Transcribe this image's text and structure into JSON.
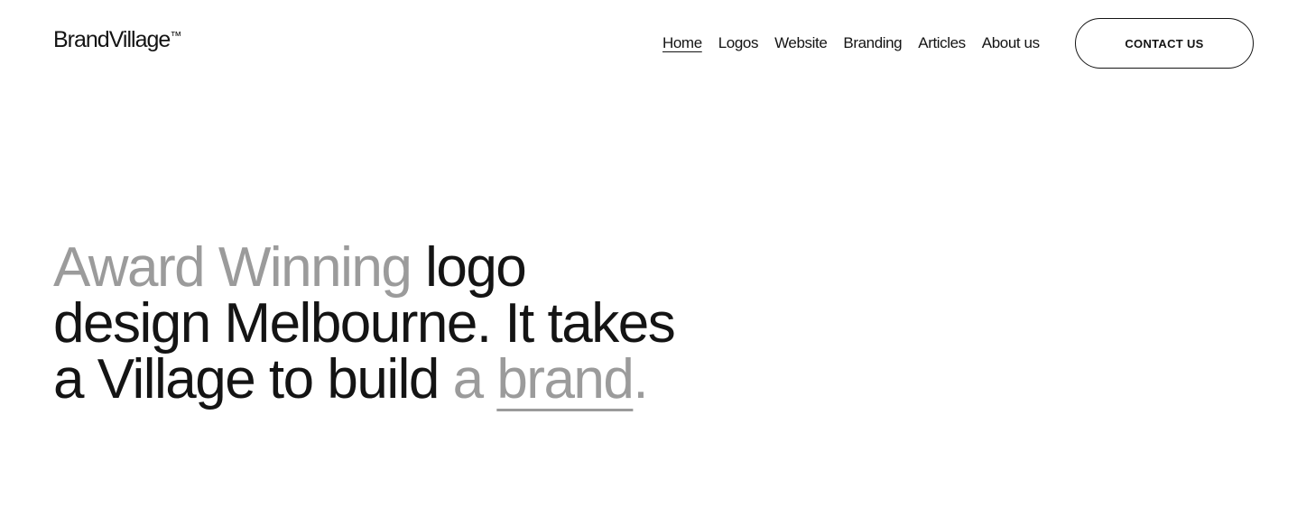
{
  "header": {
    "logo_text": "BrandVillage",
    "logo_tm": "™"
  },
  "nav": {
    "items": [
      {
        "label": "Home",
        "active": true
      },
      {
        "label": "Logos"
      },
      {
        "label": "Website"
      },
      {
        "label": "Branding"
      },
      {
        "label": "Articles"
      },
      {
        "label": "About us"
      }
    ],
    "contact_label": "CONTACT US"
  },
  "hero": {
    "part1": "Award Winning",
    "part2": " logo design Melbourne. It takes a Village to build ",
    "part3": "a ",
    "part4": "brand",
    "part5": "."
  },
  "colors": {
    "text": "#141414",
    "muted": "#9b9b9b",
    "background": "#ffffff"
  }
}
